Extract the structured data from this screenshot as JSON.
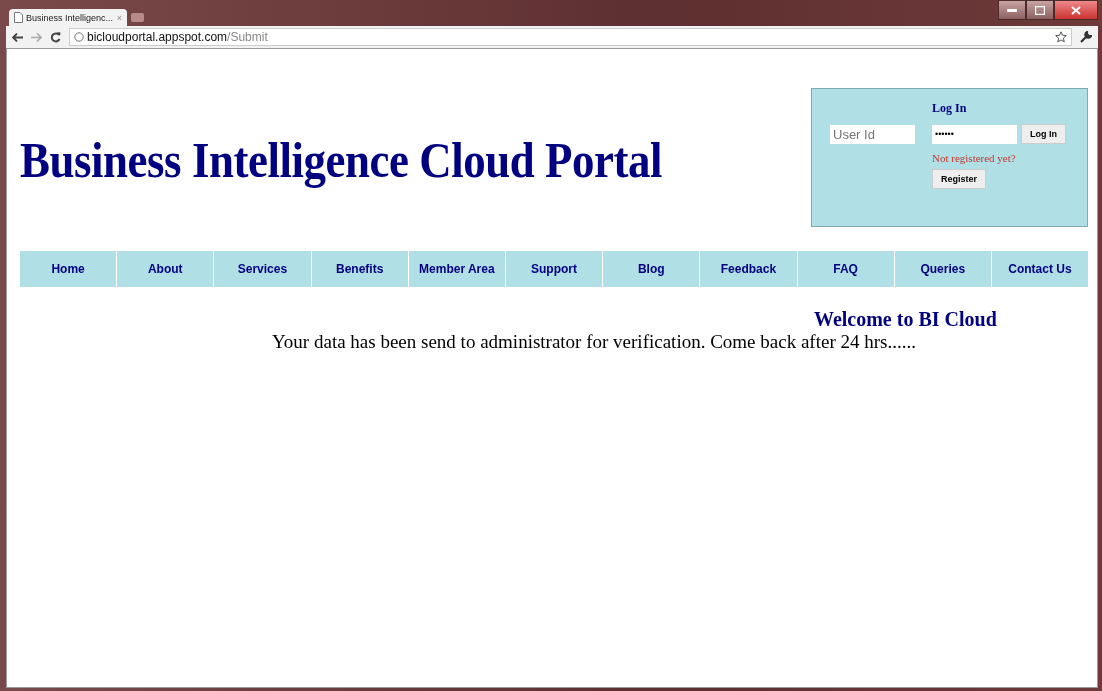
{
  "browser": {
    "tab_title": "Business Intelligenc...",
    "tab_close": "×",
    "address_host": "bicloudportal.appspot.com",
    "address_path": "/Submit"
  },
  "header": {
    "title": "Business Intelligence Cloud Portal"
  },
  "login": {
    "heading": "Log In",
    "user_placeholder": "User Id",
    "password_value": "••••••",
    "login_button": "Log In",
    "register_prompt": "Not registered yet?",
    "register_button": "Register"
  },
  "nav": {
    "items": [
      {
        "label": "Home"
      },
      {
        "label": "About"
      },
      {
        "label": "Services"
      },
      {
        "label": "Benefits"
      },
      {
        "label": "Member Area"
      },
      {
        "label": "Support"
      },
      {
        "label": "Blog"
      },
      {
        "label": "Feedback"
      },
      {
        "label": "FAQ"
      },
      {
        "label": "Queries"
      },
      {
        "label": "Contact Us"
      }
    ]
  },
  "content": {
    "welcome": "Welcome to BI Cloud",
    "message": "Your data has been send to administrator for verification. Come back after 24 hrs......"
  }
}
